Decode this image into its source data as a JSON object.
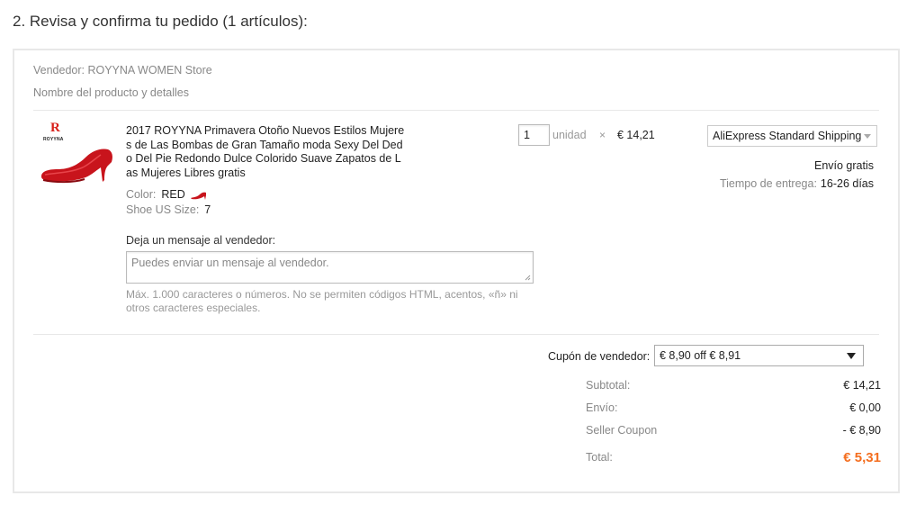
{
  "section_title": "2. Revisa y confirma tu pedido (1 artículos):",
  "seller": {
    "label": "Vendedor: ROYYNA WOMEN Store",
    "product_header": "Nombre del producto y detalles"
  },
  "product": {
    "brand_logo_text": "ROYYNA",
    "title": "2017 ROYYNA Primavera Otoño Nuevos Estilos Mujeres de Las Bombas de Gran Tamaño moda Sexy Del Dedo Del Pie Redondo Dulce Colorido Suave Zapatos de Las Mujeres Libres gratis",
    "color_label": "Color:",
    "color_value": "RED",
    "size_label": "Shoe US Size:",
    "size_value": "7",
    "quantity": "1",
    "unit": "unidad",
    "times": "×",
    "price": "€ 14,21",
    "image_color": "#c8141c"
  },
  "message": {
    "label": "Deja un mensaje al vendedor:",
    "placeholder": "Puedes enviar un mensaje al vendedor.",
    "hint": "Máx. 1.000 caracteres o números. No se permiten códigos HTML, acentos, «ñ» ni otros caracteres especiales."
  },
  "shipping": {
    "method": "AliExpress Standard Shipping",
    "free_label": "Envío gratis",
    "delivery_label": "Tiempo de entrega:",
    "delivery_value": "16-26 días"
  },
  "coupon": {
    "label": "Cupón de vendedor:",
    "selected": "€ 8,90 off € 8,91"
  },
  "summary": {
    "subtotal_label": "Subtotal:",
    "subtotal_value": "€ 14,21",
    "shipping_label": "Envío:",
    "shipping_value": "€ 0,00",
    "coupon_label": "Seller Coupon",
    "coupon_value": "- € 8,90",
    "total_label": "Total:",
    "total_value": "€ 5,31"
  },
  "colors": {
    "accent_total": "#f46e1f",
    "brand_red": "#d8201a"
  }
}
